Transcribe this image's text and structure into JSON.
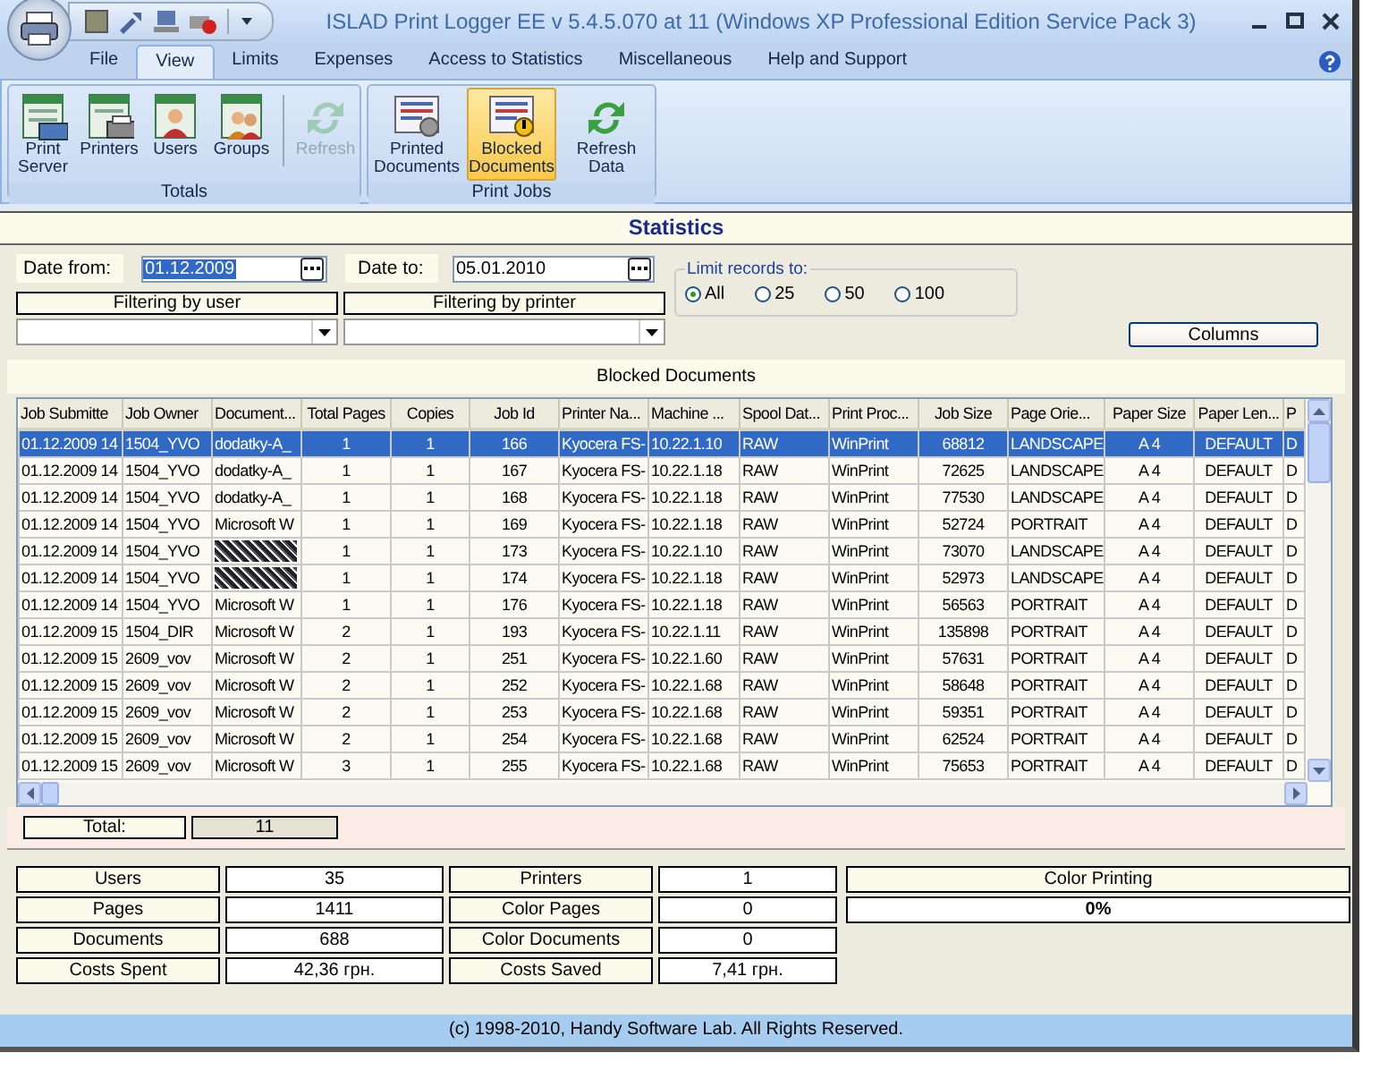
{
  "window": {
    "title": "ISLAD Print Logger EE v 5.4.5.070 at 11 (Windows XP Professional Edition Service Pack 3)"
  },
  "ribbon_tabs": [
    {
      "label": "File",
      "selected": false
    },
    {
      "label": "View",
      "selected": true
    },
    {
      "label": "Limits",
      "selected": false
    },
    {
      "label": "Expenses",
      "selected": false
    },
    {
      "label": "Access to Statistics",
      "selected": false
    },
    {
      "label": "Miscellaneous",
      "selected": false
    },
    {
      "label": "Help and Support",
      "selected": false
    }
  ],
  "ribbon_groups": [
    {
      "label": "Totals",
      "buttons": [
        {
          "label": "Print Server",
          "kind": "server",
          "disabled": false,
          "selected": false
        },
        {
          "label": "Printers",
          "kind": "printers",
          "disabled": false,
          "selected": false
        },
        {
          "label": "Users",
          "kind": "user",
          "disabled": false,
          "selected": false
        },
        {
          "label": "Groups",
          "kind": "group",
          "disabled": false,
          "selected": false
        },
        {
          "label": "Refresh",
          "kind": "refresh",
          "disabled": true,
          "selected": false
        }
      ]
    },
    {
      "label": "Print Jobs",
      "buttons": [
        {
          "label": "Printed Documents",
          "kind": "printed",
          "disabled": false,
          "selected": false
        },
        {
          "label": "Blocked Documents",
          "kind": "blocked",
          "disabled": false,
          "selected": true
        },
        {
          "label": "Refresh Data",
          "kind": "refresh",
          "disabled": false,
          "selected": false
        }
      ]
    }
  ],
  "statistics": {
    "title": "Statistics",
    "date_from": {
      "label": "Date from:",
      "value": "01.12.2009"
    },
    "date_to": {
      "label": "Date to:",
      "value": "05.01.2010"
    },
    "filter_user": {
      "label": "Filtering by user"
    },
    "filter_printer": {
      "label": "Filtering by printer"
    },
    "limit": {
      "label": "Limit records to:",
      "options": [
        {
          "label": "All",
          "selected": true
        },
        {
          "label": "25",
          "selected": false
        },
        {
          "label": "50",
          "selected": false
        },
        {
          "label": "100",
          "selected": false
        }
      ]
    },
    "columns_button": "Columns"
  },
  "grid": {
    "title": "Blocked Documents",
    "columns": [
      "Job Submitte",
      "Job Owner",
      "Document...",
      "Total Pages",
      "Copies",
      "Job Id",
      "Printer Na...",
      "Machine ...",
      "Spool Dat...",
      "Print Proc...",
      "Job Size",
      "Page Orie...",
      "Paper Size",
      "Paper Len...",
      "P"
    ],
    "rows": [
      {
        "selected": true,
        "cells": [
          "01.12.2009 14",
          "1504_YVO",
          "dodatky-A_",
          "1",
          "1",
          "166",
          "Kyocera FS-",
          "10.22.1.10",
          "RAW",
          "WinPrint",
          "68812",
          "LANDSCAPE",
          "A 4",
          "DEFAULT",
          "D"
        ]
      },
      {
        "selected": false,
        "cells": [
          "01.12.2009 14",
          "1504_YVO",
          "dodatky-A_",
          "1",
          "1",
          "167",
          "Kyocera FS-",
          "10.22.1.18",
          "RAW",
          "WinPrint",
          "72625",
          "LANDSCAPE",
          "A 4",
          "DEFAULT",
          "D"
        ]
      },
      {
        "selected": false,
        "cells": [
          "01.12.2009 14",
          "1504_YVO",
          "dodatky-A_",
          "1",
          "1",
          "168",
          "Kyocera FS-",
          "10.22.1.18",
          "RAW",
          "WinPrint",
          "77530",
          "LANDSCAPE",
          "A 4",
          "DEFAULT",
          "D"
        ]
      },
      {
        "selected": false,
        "cells": [
          "01.12.2009 14",
          "1504_YVO",
          "Microsoft W",
          "1",
          "1",
          "169",
          "Kyocera FS-",
          "10.22.1.18",
          "RAW",
          "WinPrint",
          "52724",
          "PORTRAIT",
          "A 4",
          "DEFAULT",
          "D"
        ]
      },
      {
        "selected": false,
        "cells": [
          "01.12.2009 14",
          "1504_YVO",
          {
            "kind": "obscured"
          },
          "1",
          "1",
          "173",
          "Kyocera FS-",
          "10.22.1.10",
          "RAW",
          "WinPrint",
          "73070",
          "LANDSCAPE",
          "A 4",
          "DEFAULT",
          "D"
        ]
      },
      {
        "selected": false,
        "cells": [
          "01.12.2009 14",
          "1504_YVO",
          {
            "kind": "obscured"
          },
          "1",
          "1",
          "174",
          "Kyocera FS-",
          "10.22.1.18",
          "RAW",
          "WinPrint",
          "52973",
          "LANDSCAPE",
          "A 4",
          "DEFAULT",
          "D"
        ]
      },
      {
        "selected": false,
        "cells": [
          "01.12.2009 14",
          "1504_YVO",
          "Microsoft W",
          "1",
          "1",
          "176",
          "Kyocera FS-",
          "10.22.1.18",
          "RAW",
          "WinPrint",
          "56563",
          "PORTRAIT",
          "A 4",
          "DEFAULT",
          "D"
        ]
      },
      {
        "selected": false,
        "cells": [
          "01.12.2009 15",
          "1504_DIR",
          "Microsoft W",
          "2",
          "1",
          "193",
          "Kyocera FS-",
          "10.22.1.11",
          "RAW",
          "WinPrint",
          "135898",
          "PORTRAIT",
          "A 4",
          "DEFAULT",
          "D"
        ]
      },
      {
        "selected": false,
        "cells": [
          "01.12.2009 15",
          "2609_vov",
          "Microsoft W",
          "2",
          "1",
          "251",
          "Kyocera FS-",
          "10.22.1.60",
          "RAW",
          "WinPrint",
          "57631",
          "PORTRAIT",
          "A 4",
          "DEFAULT",
          "D"
        ]
      },
      {
        "selected": false,
        "cells": [
          "01.12.2009 15",
          "2609_vov",
          "Microsoft W",
          "2",
          "1",
          "252",
          "Kyocera FS-",
          "10.22.1.68",
          "RAW",
          "WinPrint",
          "58648",
          "PORTRAIT",
          "A 4",
          "DEFAULT",
          "D"
        ]
      },
      {
        "selected": false,
        "cells": [
          "01.12.2009 15",
          "2609_vov",
          "Microsoft W",
          "2",
          "1",
          "253",
          "Kyocera FS-",
          "10.22.1.68",
          "RAW",
          "WinPrint",
          "59351",
          "PORTRAIT",
          "A 4",
          "DEFAULT",
          "D"
        ]
      },
      {
        "selected": false,
        "cells": [
          "01.12.2009 15",
          "2609_vov",
          "Microsoft W",
          "2",
          "1",
          "254",
          "Kyocera FS-",
          "10.22.1.68",
          "RAW",
          "WinPrint",
          "62524",
          "PORTRAIT",
          "A 4",
          "DEFAULT",
          "D"
        ]
      },
      {
        "selected": false,
        "cells": [
          "01.12.2009 15",
          "2609_vov",
          "Microsoft W",
          "3",
          "1",
          "255",
          "Kyocera FS-",
          "10.22.1.68",
          "RAW",
          "WinPrint",
          "75653",
          "PORTRAIT",
          "A 4",
          "DEFAULT",
          "D"
        ]
      }
    ]
  },
  "total": {
    "label": "Total:",
    "value": "11"
  },
  "summary": [
    {
      "label": "Users",
      "value": "35"
    },
    {
      "label": "Pages",
      "value": "1411"
    },
    {
      "label": "Documents",
      "value": "688"
    },
    {
      "label": "Costs Spent",
      "value": "42,36 грн."
    },
    {
      "label": "Printers",
      "value": "1"
    },
    {
      "label": "Color Pages",
      "value": "0"
    },
    {
      "label": "Color Documents",
      "value": "0"
    },
    {
      "label": "Costs Saved",
      "value": "7,41 грн."
    }
  ],
  "color_printing": {
    "label": "Color Printing",
    "value": "0%"
  },
  "footer": "(c) 1998-2010, Handy Software Lab. All Rights Reserved."
}
